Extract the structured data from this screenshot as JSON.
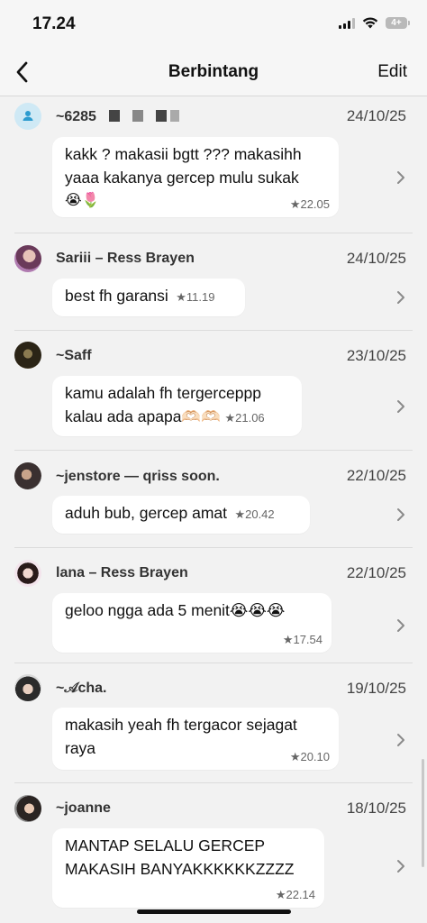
{
  "status": {
    "time": "17.24",
    "battery": "4+"
  },
  "nav": {
    "title": "Berbintang",
    "edit": "Edit",
    "back": "back"
  },
  "messages": [
    {
      "sender": "~6285",
      "date": "24/10/25",
      "line1": "kakk ? makasii bgtt ??? makasihh",
      "line2": "yaaa kakanya gercep mulu sukak",
      "line3": "😭🌷",
      "starred_time": "★22.05"
    },
    {
      "sender": "Sariii – Ress Brayen",
      "date": "24/10/25",
      "line1": "best fh garansi",
      "starred_time": "★11.19"
    },
    {
      "sender": "~Saff",
      "date": "23/10/25",
      "line1": "kamu adalah fh tergerceppp",
      "line2": "kalau ada apapa🫶🏻🫶🏻",
      "starred_time": "★21.06"
    },
    {
      "sender": "~jenstore — qriss soon.",
      "date": "22/10/25",
      "line1": "aduh bub, gercep amat",
      "starred_time": "★20.42"
    },
    {
      "sender": "lana – Ress Brayen",
      "date": "22/10/25",
      "line1": "geloo ngga ada 5 menit😭😭😭",
      "starred_time": "★17.54"
    },
    {
      "sender": "~𝒜cha.",
      "date": "19/10/25",
      "line1": "makasih yeah fh tergacor sejagat",
      "line2": "raya",
      "starred_time": "★20.10"
    },
    {
      "sender": "~joanne",
      "date": "18/10/25",
      "line1": "MANTAP SELALU GERCEP",
      "line2": "MAKASIH BANYAKKKKKKZZZZ",
      "starred_time": "★22.14"
    }
  ]
}
